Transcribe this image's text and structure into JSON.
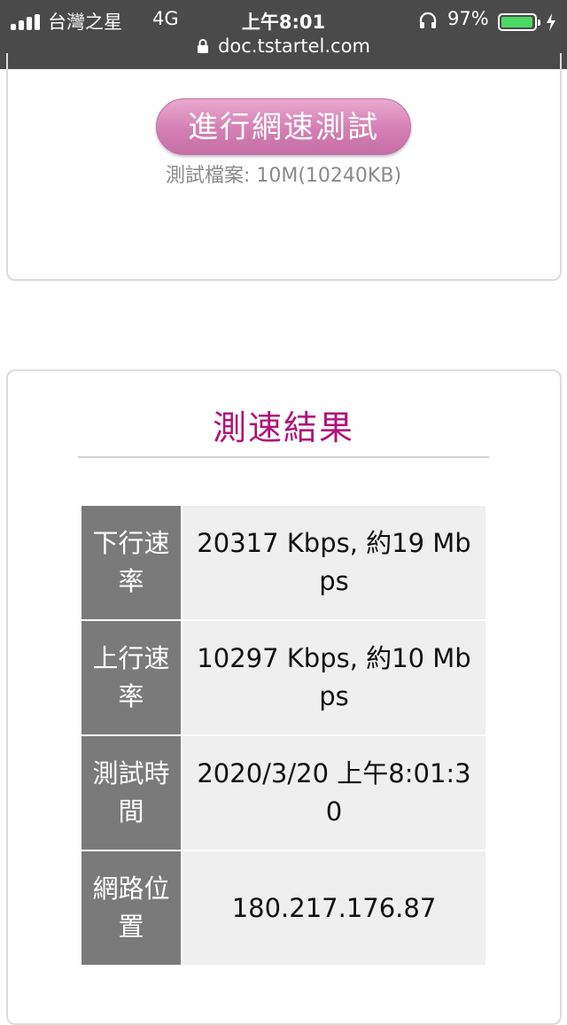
{
  "status_bar": {
    "carrier": "台灣之星",
    "network": "4G",
    "time": "上午8:01",
    "battery_percent": "97%",
    "battery_level": 0.97,
    "url": "doc.tstartel.com",
    "icons": [
      "signal-icon",
      "headphones-icon",
      "battery-icon",
      "charging-icon",
      "lock-icon"
    ]
  },
  "speed_test": {
    "button_label": "進行網速測試",
    "file_note": "測試檔案: 10M(10240KB)"
  },
  "results": {
    "title": "測速結果",
    "rows": [
      {
        "label": "下行速率",
        "value": "20317 Kbps, 約19 Mbps"
      },
      {
        "label": "上行速率",
        "value": "10297 Kbps, 約10 Mbps"
      },
      {
        "label": "測試時間",
        "value": "2020/3/20 上午8:01:30"
      },
      {
        "label": "網路位置",
        "value": "180.217.176.87"
      }
    ]
  },
  "colors": {
    "status_bg": "#4a4a4a",
    "accent_title": "#b0127a",
    "button_pink": "#d37fb3",
    "header_cell": "#7a7a7a",
    "value_cell": "#efefef"
  }
}
